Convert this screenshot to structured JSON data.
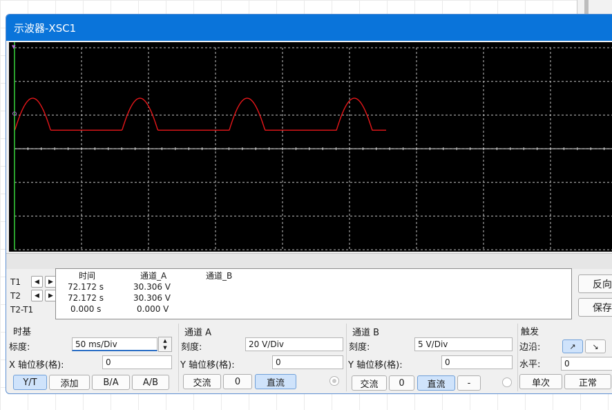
{
  "window": {
    "title": "示波器-XSC1"
  },
  "scope": {
    "background": "#000000",
    "grid_color": "#bfbfbf",
    "trace_a_color": "#e8171a",
    "cursor_color": "#37d23a",
    "marker_color": "#b46ad6",
    "marker_symbol": "▾",
    "waveform": {
      "description_note": "",
      "low_divs": 0.55,
      "peak_divs": 1.5,
      "period_ms": 80,
      "ms_per_div": 50,
      "divs_shown": 10,
      "visible_until_div": 5.55
    }
  },
  "cursors": {
    "t1_label": "T1",
    "t2_label": "T2",
    "diff_label": "T2-T1",
    "left_arrow": "◀",
    "right_arrow": "▶"
  },
  "readout": {
    "headers": [
      "时间",
      "通道_A",
      "通道_B"
    ],
    "rows": [
      [
        "72.172 s",
        "30.306 V",
        ""
      ],
      [
        "72.172 s",
        "30.306 V",
        ""
      ],
      [
        "0.000 s",
        "0.000 V",
        ""
      ]
    ]
  },
  "side_buttons": {
    "reverse": "反向",
    "save": "保存"
  },
  "timebase": {
    "title": "时基",
    "scale_label": "标度:",
    "scale_value": "50 ms/Div",
    "x_offset_label": "X 轴位移(格):",
    "x_offset_value": "0",
    "buttons": [
      "Y/T",
      "添加",
      "B/A",
      "A/B"
    ]
  },
  "channel_a": {
    "title": "通道 A",
    "scale_label": "刻度:",
    "scale_value": "20  V/Div",
    "y_offset_label": "Y 轴位移(格):",
    "y_offset_value": "0",
    "ac_label": "交流",
    "zero_label": "0",
    "dc_label": "直流"
  },
  "channel_b": {
    "title": "通道 B",
    "scale_label": "刻度:",
    "scale_value": "5  V/Div",
    "y_offset_label": "Y 轴位移(格):",
    "y_offset_value": "0",
    "ac_label": "交流",
    "zero_label": "0",
    "dc_label": "直流",
    "minus_label": "-"
  },
  "trigger": {
    "title": "触发",
    "edge_label": "边沿:",
    "rising_icon": "↗",
    "falling_icon": "↘",
    "level_label": "水平:",
    "level_value": "0",
    "single_label": "单次",
    "normal_label": "正常"
  }
}
